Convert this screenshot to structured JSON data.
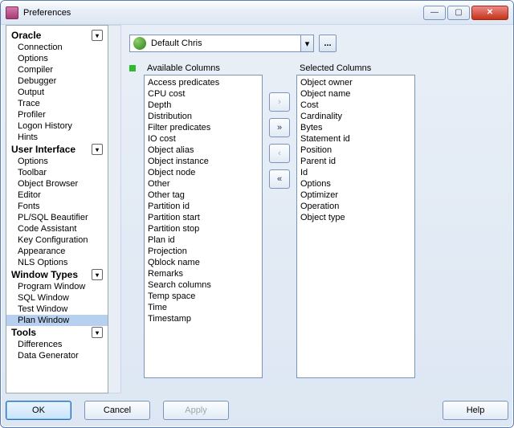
{
  "window": {
    "title": "Preferences"
  },
  "nav": {
    "sections": [
      {
        "label": "Oracle",
        "items": [
          "Connection",
          "Options",
          "Compiler",
          "Debugger",
          "Output",
          "Trace",
          "Profiler",
          "Logon History",
          "Hints"
        ]
      },
      {
        "label": "User Interface",
        "items": [
          "Options",
          "Toolbar",
          "Object Browser",
          "Editor",
          "Fonts",
          "PL/SQL Beautifier",
          "Code Assistant",
          "Key Configuration",
          "Appearance",
          "NLS Options"
        ]
      },
      {
        "label": "Window Types",
        "items": [
          "Program Window",
          "SQL Window",
          "Test Window",
          "Plan Window"
        ]
      },
      {
        "label": "Tools",
        "items": [
          "Differences",
          "Data Generator"
        ]
      }
    ],
    "selected": "Plan Window"
  },
  "profile": {
    "value": "Default Chris",
    "more": "..."
  },
  "columns": {
    "available_label": "Available Columns",
    "selected_label": "Selected Columns",
    "available": [
      "Access predicates",
      "CPU cost",
      "Depth",
      "Distribution",
      "Filter predicates",
      "IO cost",
      "Object alias",
      "Object instance",
      "Object node",
      "Other",
      "Other tag",
      "Partition id",
      "Partition start",
      "Partition stop",
      "Plan id",
      "Projection",
      "Qblock name",
      "Remarks",
      "Search columns",
      "Temp space",
      "Time",
      "Timestamp"
    ],
    "selected": [
      "Object owner",
      "Object name",
      "Cost",
      "Cardinality",
      "Bytes",
      "Statement id",
      "Position",
      "Parent id",
      "Id",
      "Options",
      "Optimizer",
      "Operation",
      "Object type"
    ],
    "move": {
      "right": "›",
      "all_right": "»",
      "left": "‹",
      "all_left": "«"
    }
  },
  "buttons": {
    "ok": "OK",
    "cancel": "Cancel",
    "apply": "Apply",
    "help": "Help"
  }
}
